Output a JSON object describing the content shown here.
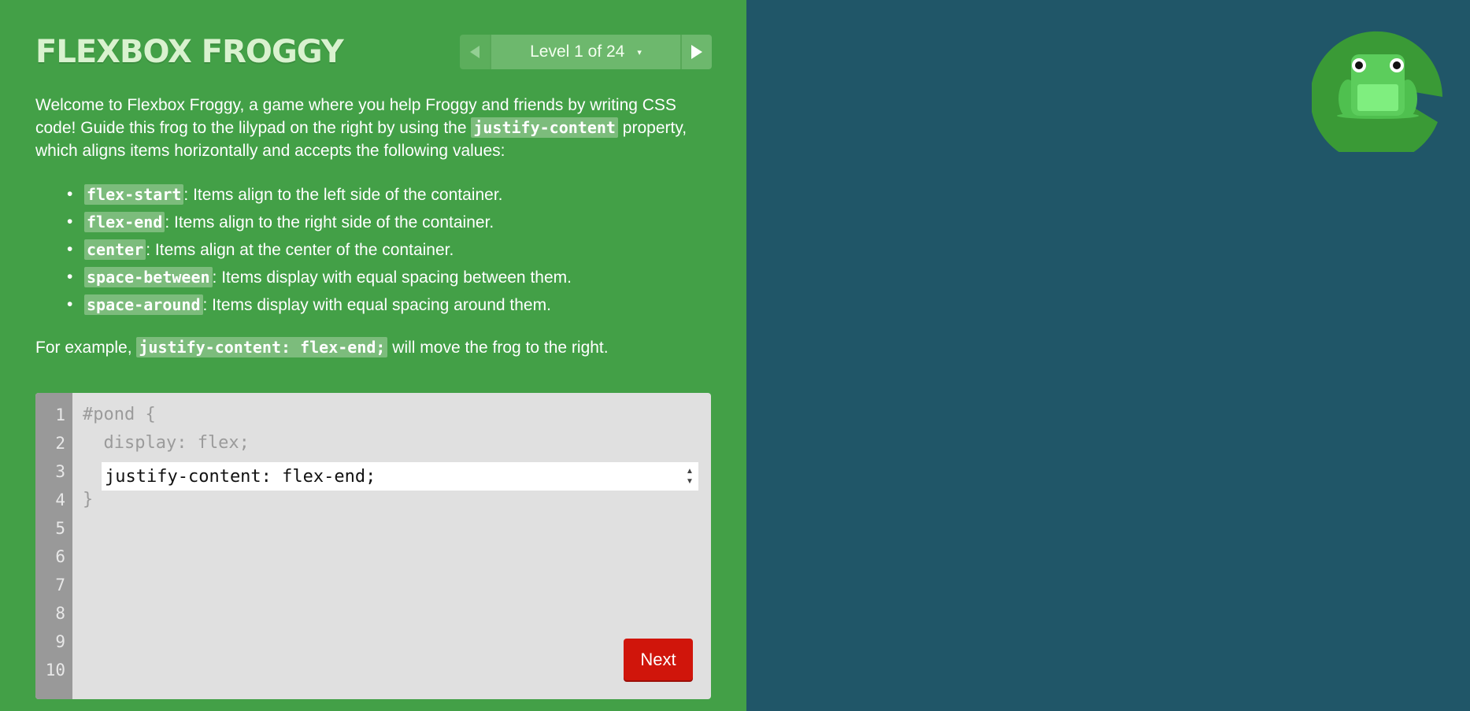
{
  "app": {
    "title": "FLEXBOX FROGGY"
  },
  "level_nav": {
    "prev_icon": "triangle-left-icon",
    "next_icon": "triangle-right-icon",
    "level_text": "Level 1 of 24",
    "caret": "▾"
  },
  "instructions": {
    "intro_part1": "Welcome to Flexbox Froggy, a game where you help Froggy and friends by writing CSS code! Guide this frog to the lilypad on the right by using the ",
    "intro_code": "justify-content",
    "intro_part2": " property, which aligns items horizontally and accepts the following values:",
    "values": [
      {
        "code": "flex-start",
        "desc": ": Items align to the left side of the container."
      },
      {
        "code": "flex-end",
        "desc": ": Items align to the right side of the container."
      },
      {
        "code": "center",
        "desc": ": Items align at the center of the container."
      },
      {
        "code": "space-between",
        "desc": ": Items display with equal spacing between them."
      },
      {
        "code": "space-around",
        "desc": ": Items display with equal spacing around them."
      }
    ],
    "example_prefix": "For example, ",
    "example_code": "justify-content: flex-end;",
    "example_suffix": " will move the frog to the right."
  },
  "editor": {
    "line_numbers": [
      "1",
      "2",
      "3",
      "4",
      "5",
      "6",
      "7",
      "8",
      "9",
      "10"
    ],
    "line1": "#pond {",
    "line2": "  display: flex;",
    "input_value": "justify-content: flex-end;",
    "line4": "}",
    "next_label": "Next"
  },
  "board": {
    "lilypad_icon": "lilypad-icon",
    "frog_icon": "frog-icon"
  },
  "colors": {
    "sidebar": "#43a047",
    "board": "#205668",
    "editor": "#e0e0e0",
    "gutter": "#999999",
    "next_button": "#d0150b",
    "lilypad": "#3a9a36",
    "frog": "#5ccd5c"
  }
}
